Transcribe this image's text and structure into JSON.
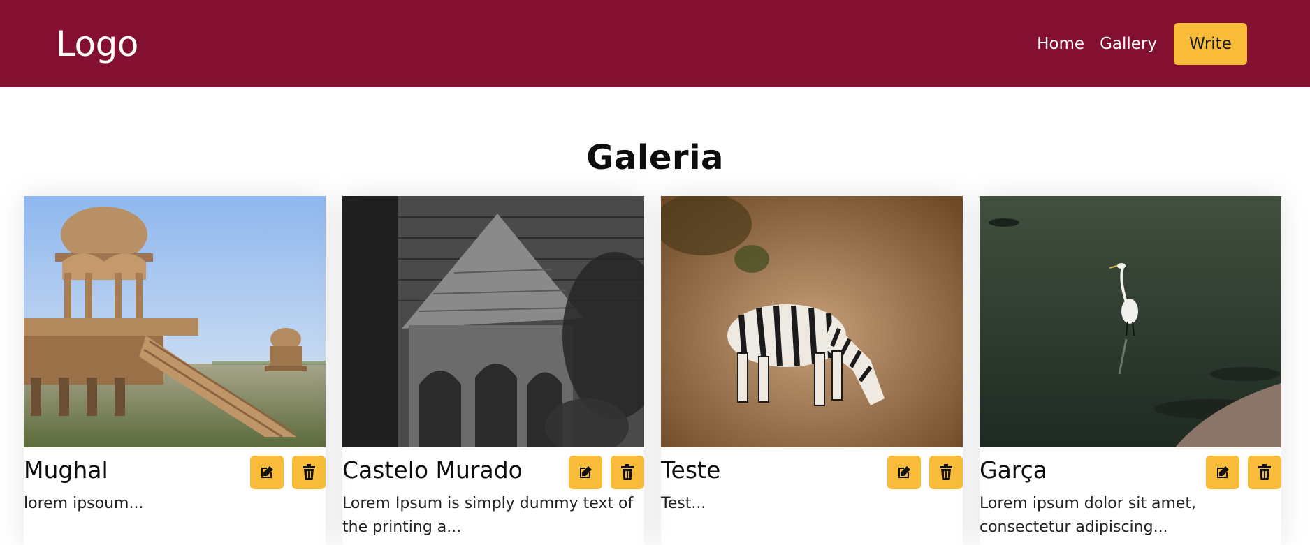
{
  "navbar": {
    "logo": "Logo",
    "links": [
      "Home",
      "Gallery"
    ],
    "write_label": "Write",
    "background": "#841031",
    "accent": "#f8bc3a"
  },
  "page": {
    "title": "Galeria"
  },
  "cards": [
    {
      "title": "Mughal",
      "description": "lorem ipsoum...",
      "image_subject": "sandstone chhatri pavilion with steps in a lake under blue sky"
    },
    {
      "title": "Castelo Murado",
      "description": "Lorem Ipsum is simply dummy text of the printing a...",
      "image_subject": "black and white stone tower with conical roof and tree"
    },
    {
      "title": "Teste",
      "description": "Test...",
      "image_subject": "zebra grazing on brown ground"
    },
    {
      "title": "Garça",
      "description": "Lorem ipsum dolor sit amet, consectetur adipiscing...",
      "image_subject": "white heron standing in dark green water"
    }
  ],
  "icons": {
    "edit": "edit-icon",
    "delete": "trash-icon"
  }
}
